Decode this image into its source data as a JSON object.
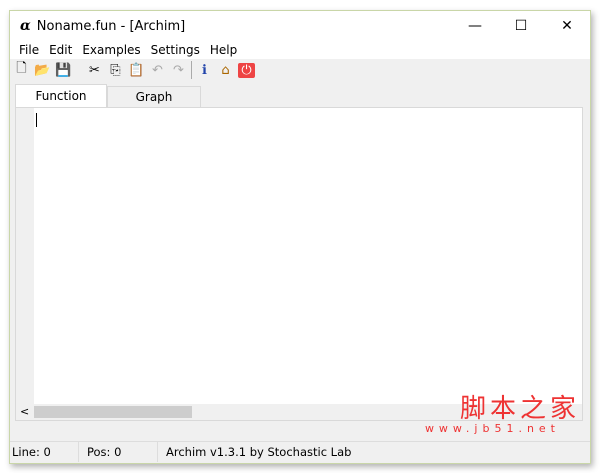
{
  "window": {
    "logo": "α",
    "title": "Noname.fun - [Archim]",
    "minimize": "—",
    "maximize": "☐",
    "close": "✕"
  },
  "menu": [
    "File",
    "Edit",
    "Examples",
    "Settings",
    "Help"
  ],
  "toolbar": [
    {
      "name": "new-icon",
      "glyph": "🗋"
    },
    {
      "name": "open-icon",
      "glyph": "📂"
    },
    {
      "name": "save-icon",
      "glyph": "💾"
    },
    {
      "name": "cut-icon",
      "glyph": "✂"
    },
    {
      "name": "copy-icon",
      "glyph": "⎘"
    },
    {
      "name": "paste-icon",
      "glyph": "📋"
    },
    {
      "name": "undo-icon",
      "glyph": "↶"
    },
    {
      "name": "redo-icon",
      "glyph": "↷"
    },
    {
      "name": "info-icon",
      "glyph": "ℹ"
    },
    {
      "name": "home-icon",
      "glyph": "⌂"
    },
    {
      "name": "power-icon",
      "glyph": "⏻"
    }
  ],
  "tabs": [
    "Function",
    "Graph"
  ],
  "status": {
    "line": "Line: 0",
    "pos": "Pos: 0",
    "about": "Archim v1.3.1 by Stochastic Lab"
  },
  "watermark": {
    "text": "脚本之家",
    "url": "www.jb51.net"
  },
  "scroll_left": "<"
}
